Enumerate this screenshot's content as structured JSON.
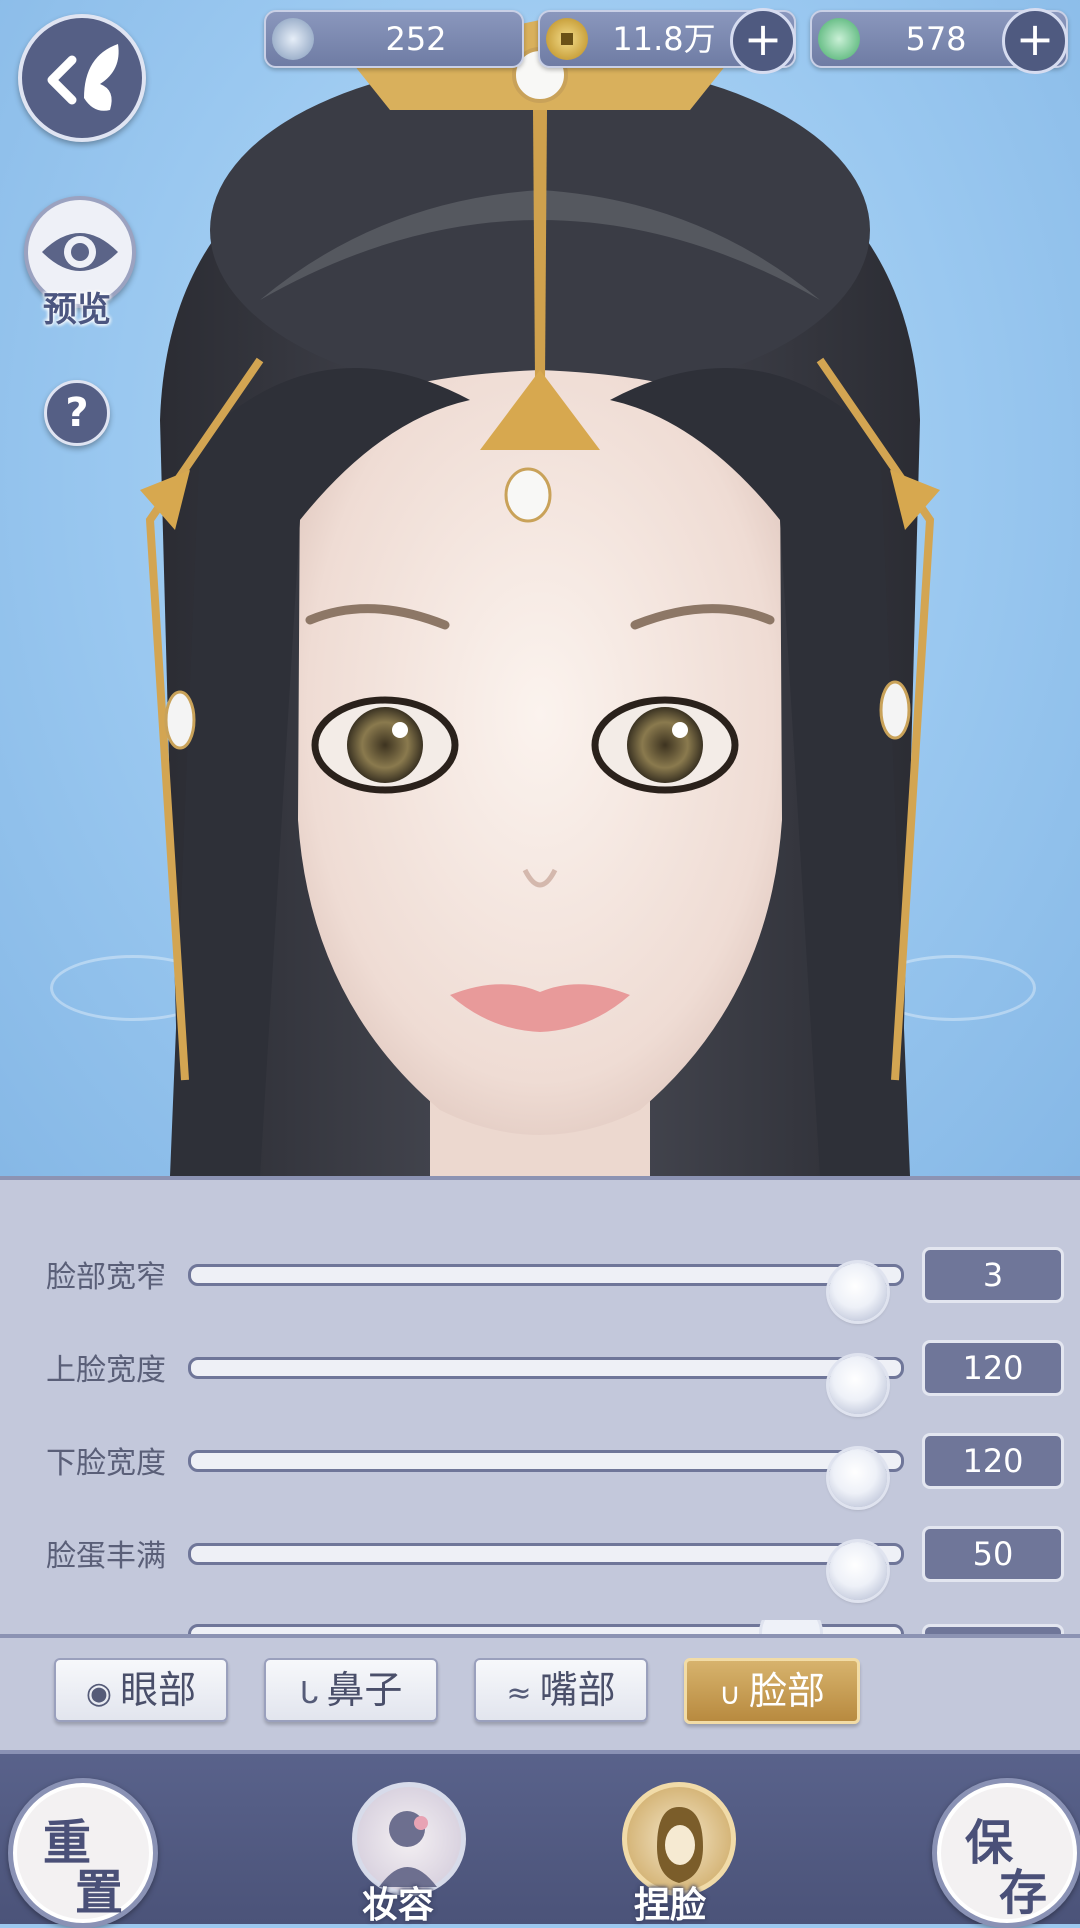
{
  "currency": [
    {
      "name": "silver",
      "value": "252"
    },
    {
      "name": "coin",
      "value": "11.8万"
    },
    {
      "name": "jade",
      "value": "578"
    }
  ],
  "currency_add_symbol": "+",
  "preview_label": "预览",
  "help_symbol": "?",
  "sliders": [
    {
      "label": "脸部宽窄",
      "value": "3",
      "level": 0.94
    },
    {
      "label": "上脸宽度",
      "value": "120",
      "level": 0.94
    },
    {
      "label": "下脸宽度",
      "value": "120",
      "level": 0.94
    },
    {
      "label": "脸蛋丰满",
      "value": "50",
      "level": 0.94
    }
  ],
  "category_tabs": [
    {
      "label": "眼部",
      "icon": "eye-icon",
      "active": false
    },
    {
      "label": "鼻子",
      "icon": "nose-icon",
      "active": false
    },
    {
      "label": "嘴部",
      "icon": "mouth-icon",
      "active": false
    },
    {
      "label": "脸部",
      "icon": "face-icon",
      "active": true
    }
  ],
  "bottom_nav": {
    "reset_top": "重",
    "reset_bottom": "置",
    "makeup_label": "妆容",
    "face_label": "捏脸",
    "save_top": "保",
    "save_bottom": "存"
  },
  "colors": {
    "accent_gold": "#c9a259",
    "panel": "#c3c8db",
    "nav": "#4f5780"
  }
}
